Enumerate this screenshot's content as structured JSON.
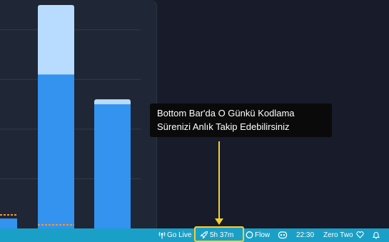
{
  "chart_data": {
    "type": "bar",
    "stacked": true,
    "series": [
      {
        "values": [
          0.2,
          3.1,
          2.5
        ]
      },
      {
        "values": [
          0.0,
          1.4,
          0.1
        ]
      }
    ],
    "ylim": [
      0,
      4.6
    ],
    "grid": true,
    "colors": {
      "lower": "#3393ef",
      "upper": "#b8dcff",
      "average_line": "#ef9b2a"
    }
  },
  "tooltip": {
    "line1": "Bottom Bar'da O Günkü Kodlama",
    "line2": "Sürenizi Anlık Takip Edebilirsiniz"
  },
  "statusbar": {
    "go_live_icon": "broadcast-icon",
    "go_live": "Go Live",
    "timer_icon": "rocket-icon",
    "timer": "5h 37m",
    "flow_icon": "circle-icon",
    "flow": "Flow",
    "copilot_icon": "copilot-icon",
    "time": "22:30",
    "theme": "Zero Two",
    "heart_icon": "heart-icon",
    "bell_icon": "bell-icon"
  }
}
